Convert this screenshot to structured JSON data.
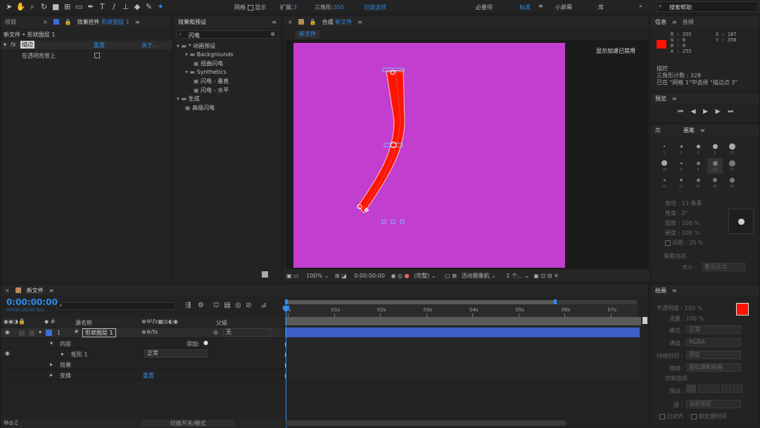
{
  "toolbar": {
    "snap_label": "网格",
    "show_label": "显示",
    "expand_label": "扩展:",
    "expand_value": "3",
    "triangles_label": "三角形:",
    "triangles_value": "350",
    "record": "记录选项",
    "ws_essentials": "必要项",
    "ws_standard": "标准",
    "ws_small": "小屏幕",
    "ws_library": "库",
    "search_help": "搜索帮助"
  },
  "project_panel": {
    "tab_project": "项目",
    "tab_effects_controls": "效果控件",
    "tab_effects_layer": "形状图层 1",
    "breadcrumb": "新文件 • 形状图层 1",
    "fx_label": "fx",
    "effect_name": "描边",
    "reset": "重置",
    "about": "关于...",
    "param": "在透明背景上"
  },
  "effects_presets": {
    "title": "效果和预设",
    "search_value": "闪电",
    "tree": [
      {
        "label": "* 动画预设",
        "level": 0,
        "type": "folder"
      },
      {
        "label": "Backgrounds",
        "level": 1,
        "type": "folder"
      },
      {
        "label": "扭曲闪电",
        "level": 2,
        "type": "preset"
      },
      {
        "label": "Synthetics",
        "level": 1,
        "type": "folder"
      },
      {
        "label": "闪电 - 垂直",
        "level": 2,
        "type": "preset"
      },
      {
        "label": "闪电 - 水平",
        "level": 2,
        "type": "preset"
      },
      {
        "label": "生成",
        "level": 0,
        "type": "folder"
      },
      {
        "label": "高级闪电",
        "level": 1,
        "type": "preset"
      }
    ]
  },
  "composition": {
    "title_prefix": "合成",
    "title": "新文件",
    "sub_tab": "新文件",
    "accel_notice": "显示加速已禁用",
    "zoom": "100%",
    "timecode": "0:00:00:00",
    "quality": "(完整)",
    "camera": "活动摄像机",
    "views": "1 个...",
    "bg_color": "#C23ECE",
    "stroke_color": "#FF1400"
  },
  "info_panel": {
    "tab_info": "信息",
    "tab_audio": "音频",
    "r": "R : 255",
    "g": "G : 0",
    "b": "B : 0",
    "a": "A : 255",
    "x": "X : 187",
    "y": "Y : 350",
    "color": "#FF1400",
    "line1": "描控",
    "line2": "三角形计数 : 328",
    "line3": "已在 \"网格 1\"中选择 \"描边点 3\""
  },
  "preview": {
    "title": "预览"
  },
  "library": {
    "tab_library": "库",
    "tab_brush": "画笔",
    "brush_sizes": [
      "1",
      "3",
      "5",
      "9",
      "13",
      "19",
      "5",
      "9",
      "13",
      "17",
      "21",
      "27",
      "35",
      "45",
      "65"
    ],
    "diameter": "直径 : 13 像素",
    "angle": "角度 : 0°",
    "roundness": "圆度 : 100 %",
    "hardness": "硬度 : 100 %",
    "spacing": "间距 : 25 %",
    "brush_dynamics": "画笔动态",
    "size": "大小 :",
    "size_value": "笔尖压力"
  },
  "paint": {
    "title": "绘画",
    "opacity": "不透明度 : 100 %",
    "flow": "流量 : 100 %",
    "mode": "模式 :",
    "mode_value": "正常",
    "channels": "通道 :",
    "channels_value": "RGBA",
    "duration": "持续时间 :",
    "duration_value": "固定",
    "erase": "擦除 :",
    "erase_value": "图层源和绘画",
    "clone_options": "仿制选项",
    "preset": "预设 :",
    "source": "源 :",
    "source_value": "当前图层",
    "aligned": "已对齐",
    "lock_source": "锁定源时间",
    "fg_color": "#FF1400",
    "bg_color": "#FFFFFF"
  },
  "timeline": {
    "tab": "新文件",
    "timecode": "0:00:00:00",
    "fps": "00000 (25.00 fps)",
    "col_source": "源名称",
    "col_parent": "父级",
    "layer_num": "1",
    "layer_name": "形状图层 1",
    "parent_value": "无",
    "contents": "内容",
    "add": "添加:",
    "shape": "矩形 1",
    "blend": "正常",
    "effects": "效果",
    "transform": "变换",
    "reset": "重置",
    "toggle_modes": "切换开关/模式",
    "ticks": [
      "0s",
      "01s",
      "02s",
      "03s",
      "04s",
      "05s",
      "06s",
      "07s"
    ],
    "layer_bar_color": "#3E5FC8"
  }
}
